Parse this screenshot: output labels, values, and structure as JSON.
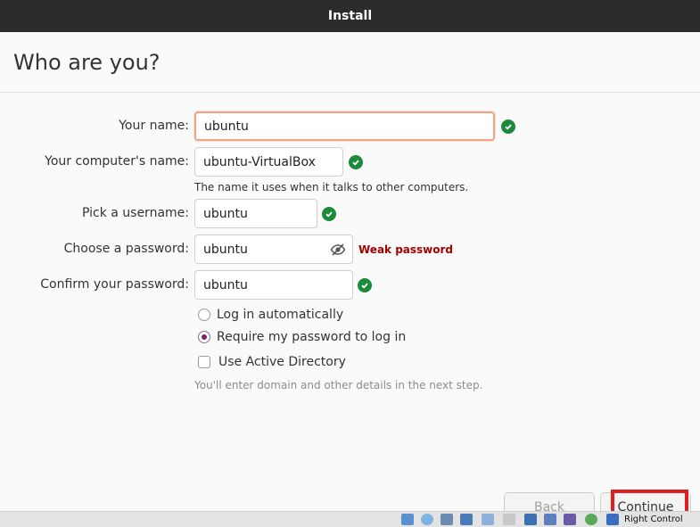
{
  "window": {
    "title": "Install"
  },
  "page": {
    "title": "Who are you?"
  },
  "form": {
    "name": {
      "label": "Your name:",
      "value": "ubuntu"
    },
    "computer": {
      "label": "Your computer's name:",
      "value": "ubuntu-VirtualBox",
      "hint": "The name it uses when it talks to other computers."
    },
    "username": {
      "label": "Pick a username:",
      "value": "ubuntu"
    },
    "password": {
      "label": "Choose a password:",
      "value": "ubuntu",
      "strength": "Weak password"
    },
    "confirm": {
      "label": "Confirm your password:",
      "value": "ubuntu"
    }
  },
  "options": {
    "auto_login": {
      "label": "Log in automatically",
      "selected": false
    },
    "require_password": {
      "label": "Require my password to log in",
      "selected": true
    },
    "active_directory": {
      "label": "Use Active Directory",
      "checked": false,
      "hint": "You'll enter domain and other details in the next step."
    }
  },
  "buttons": {
    "back": "Back",
    "continue": "Continue"
  },
  "taskbar": {
    "host_key": "Right Control"
  },
  "colors": {
    "accent": "#77216f",
    "success": "#1b8a3a",
    "warning": "#a40000",
    "highlight": "#e02020"
  }
}
